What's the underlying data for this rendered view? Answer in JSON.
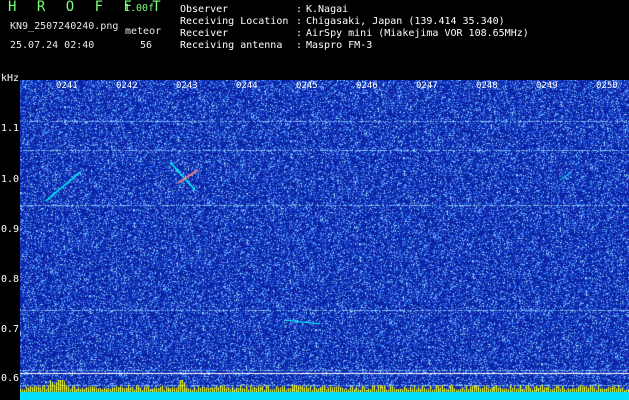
{
  "header": {
    "brand": "H R O F F T",
    "version": "1.00f",
    "filename": "KN9_2507240240.png",
    "datetime": "25.07.24 02:40",
    "meteor_label": "meteor",
    "meteor_count": "56"
  },
  "info": [
    {
      "label": "Observer",
      "value": "K.Nagai"
    },
    {
      "label": "Receiving Location",
      "value": "Chigasaki, Japan (139.414 35.340)"
    },
    {
      "label": "Receiver",
      "value": "AirSpy mini (Miakejima VOR 108.65MHz)"
    },
    {
      "label": "Receiving antenna",
      "value": "Maspro FM-3"
    }
  ],
  "axis": {
    "y_unit": "kHz",
    "y_ticks": [
      "1.1",
      "1.0",
      "0.9",
      "0.8",
      "0.7",
      "0.6"
    ],
    "x_ticks": [
      "0241",
      "0242",
      "0243",
      "0244",
      "0245",
      "0246",
      "0247",
      "0248",
      "0249",
      "0250"
    ]
  },
  "colors": {
    "background": "#0a1fa0",
    "noise": "#4aa0ff",
    "signal": "#00ffff",
    "bars": "#ffff00",
    "baseline": "#00e0ff"
  }
}
